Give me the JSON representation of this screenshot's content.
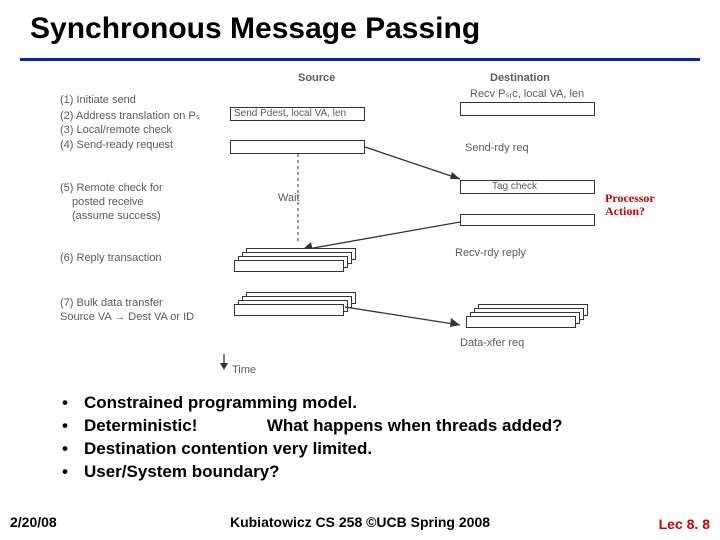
{
  "title": "Synchronous Message Passing",
  "diagram": {
    "col_source": "Source",
    "col_dest": "Destination",
    "dest_sub": "Recv Pₛᵣc, local VA, len",
    "step1": "(1) Initiate send",
    "step2": "(2) Address translation on Pₛ",
    "step3": "(3) Local/remote check",
    "step4": "(4) Send-ready request",
    "step5a": "(5) Remote check for",
    "step5b": "posted receive",
    "step5c": "(assume success)",
    "step6": "(6) Reply transaction",
    "step7a": "(7) Bulk data transfer",
    "step7b": "Source VA → Dest VA or ID",
    "src_box_label": "Send Pdest, local VA, len",
    "send_rdy": "Send-rdy req",
    "wait": "Wait",
    "tag_check": "Tag check",
    "recv_rdy": "Recv-rdy reply",
    "data_xfer": "Data-xfer req",
    "time": "Time",
    "annot": "Processor\nAction?"
  },
  "bullets": {
    "b1": "Constrained programming model.",
    "b2a": "Deterministic!",
    "b2b": "What happens when threads added?",
    "b3": "Destination contention very limited.",
    "b4": "User/System boundary?"
  },
  "footer": {
    "date": "2/20/08",
    "center": "Kubiatowicz CS 258 ©UCB Spring 2008",
    "right": "Lec 8. 8"
  }
}
